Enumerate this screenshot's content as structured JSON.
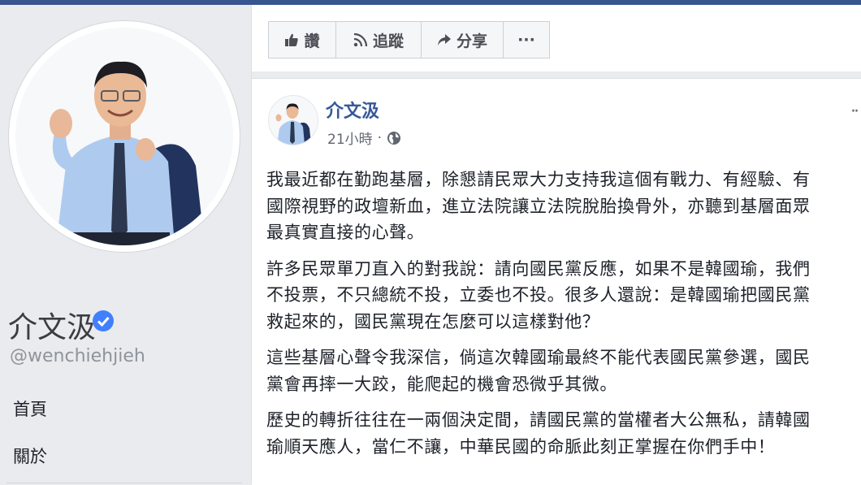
{
  "profile": {
    "name": "介文汲",
    "handle": "@wenchiehjieh",
    "nav": [
      "首頁",
      "關於"
    ]
  },
  "actions": {
    "like": "讚",
    "follow": "追蹤",
    "share": "分享",
    "more": "···"
  },
  "post": {
    "author": "介文汲",
    "time": "21小時",
    "paragraphs": [
      "我最近都在勤跑基層，除懇請民眾大力支持我這個有戰力、有經驗、有\n國際視野的政壇新血，進立法院讓立法院脫胎換骨外，亦聽到基層面眾\n最真實直接的心聲。",
      "許多民眾單刀直入的對我說：請向國民黨反應，如果不是韓國瑜，我們\n不投票，不只總統不投，立委也不投。很多人還說：是韓國瑜把國民黨\n救起來的，國民黨現在怎麼可以這樣對他？",
      "這些基層心聲令我深信，倘這次韓國瑜最終不能代表國民黨參選，國民\n黨會再摔一大跤，能爬起的機會恐微乎其微。",
      "歷史的轉折往往在一兩個決定間，請國民黨的當權者大公無私，請韓國\n瑜順天應人，當仁不讓，中華民國的命脈此刻正掌握在你們手中！"
    ]
  },
  "colors": {
    "brand_blue": "#365899",
    "verified_blue": "#4080ff",
    "topbar": "#37558f"
  }
}
